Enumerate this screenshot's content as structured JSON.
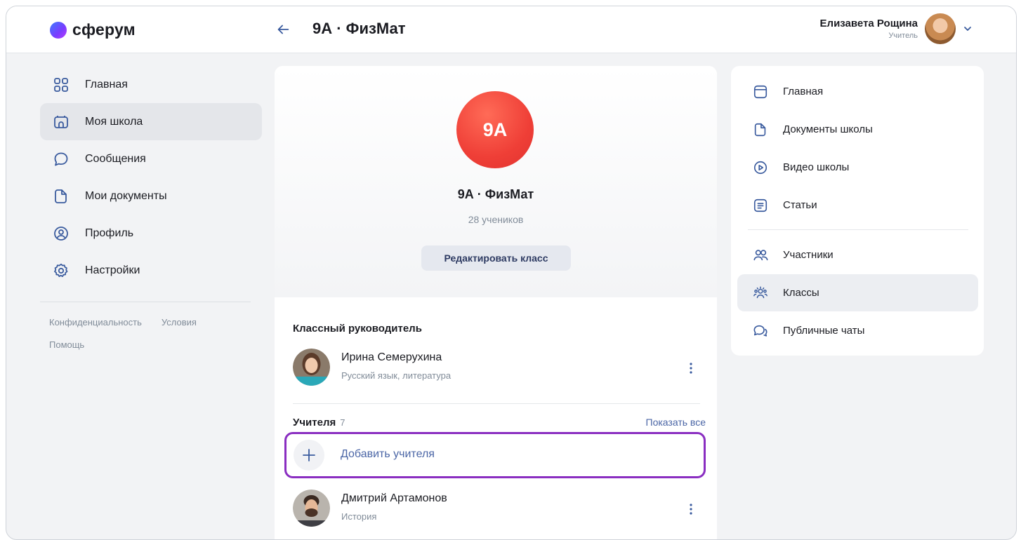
{
  "header": {
    "logo_text": "сферум",
    "page_title": "9А · ФизМат",
    "user_name": "Елизавета Рощина",
    "user_role": "Учитель"
  },
  "left_nav": {
    "items": [
      {
        "label": "Главная",
        "icon": "grid-icon"
      },
      {
        "label": "Моя школа",
        "icon": "school-icon"
      },
      {
        "label": "Сообщения",
        "icon": "chat-icon"
      },
      {
        "label": "Мои документы",
        "icon": "document-icon"
      },
      {
        "label": "Профиль",
        "icon": "profile-icon"
      },
      {
        "label": "Настройки",
        "icon": "gear-icon"
      }
    ],
    "active_index": 1,
    "footer": {
      "privacy": "Конфиденциальность",
      "terms": "Условия",
      "help": "Помощь"
    }
  },
  "class_card": {
    "avatar_text": "9А",
    "title": "9А · ФизМат",
    "students_count": "28 учеников",
    "edit_button": "Редактировать класс",
    "homeroom_heading": "Классный руководитель",
    "homeroom_teacher": {
      "name": "Ирина Семерухина",
      "subject": "Русский язык, литература"
    },
    "teachers_heading": "Учителя",
    "teachers_count": "7",
    "show_all": "Показать все",
    "add_teacher": "Добавить учителя",
    "teachers": [
      {
        "name": "Дмитрий Артамонов",
        "subject": "История"
      }
    ]
  },
  "right_nav": {
    "items": [
      {
        "label": "Главная",
        "icon": "window-icon"
      },
      {
        "label": "Документы школы",
        "icon": "document-icon"
      },
      {
        "label": "Видео школы",
        "icon": "play-icon"
      },
      {
        "label": "Статьи",
        "icon": "article-icon"
      },
      {
        "label": "Участники",
        "icon": "users-icon"
      },
      {
        "label": "Классы",
        "icon": "classes-icon"
      },
      {
        "label": "Публичные чаты",
        "icon": "public-chats-icon"
      }
    ],
    "active_index": 5
  },
  "colors": {
    "accent": "#4b66a6",
    "highlight_border": "#8a2ec1",
    "class_avatar": "#ef3f37",
    "background": "#f2f3f5"
  }
}
